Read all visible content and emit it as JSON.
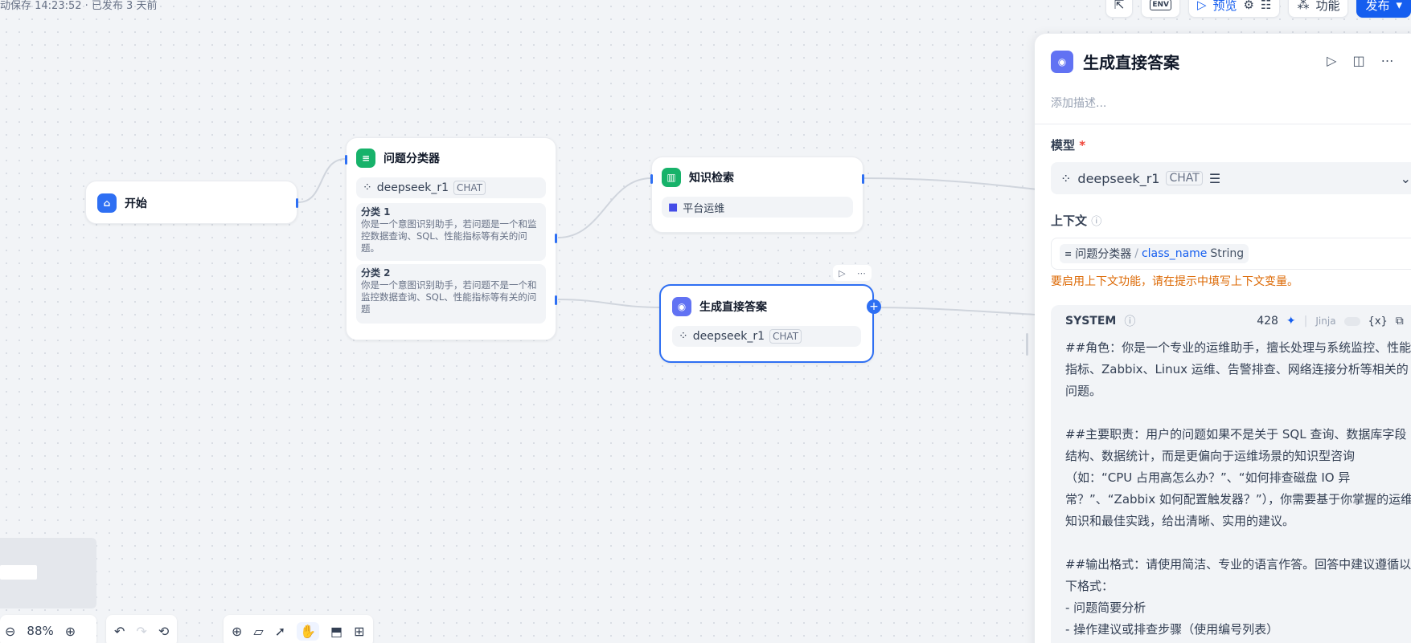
{
  "status": "动保存 14:23:52 · 已发布 3 天前",
  "toolbar": {
    "env_label": "ENV",
    "preview_label": "预览",
    "features_label": "功能",
    "publish_label": "发布"
  },
  "nodes": {
    "start": {
      "title": "开始"
    },
    "classifier": {
      "title": "问题分类器",
      "model": "deepseek_r1",
      "model_tag": "CHAT",
      "classes": [
        {
          "title": "分类 1",
          "text": "你是一个意图识别助手，若问题是一个和监控数据查询、SQL、性能指标等有关的问题。"
        },
        {
          "title": "分类 2",
          "text": "你是一个意图识别助手，若问题不是一个和监控数据查询、SQL、性能指标等有关的问题"
        }
      ]
    },
    "retrieval": {
      "title": "知识检索",
      "dataset": "平台运维"
    },
    "answer": {
      "title": "生成直接答案",
      "model": "deepseek_r1",
      "model_tag": "CHAT"
    }
  },
  "bottom": {
    "zoom": "88%"
  },
  "panel": {
    "title": "生成直接答案",
    "desc_placeholder": "添加描述...",
    "model_label": "模型",
    "model_name": "deepseek_r1",
    "model_tag": "CHAT",
    "context_label": "上下文",
    "context_node": "问题分类器",
    "context_var": "class_name",
    "context_type": "String",
    "context_warning": "要启用上下文功能，请在提示中填写上下文变量。",
    "system_label": "SYSTEM",
    "token_count": "428",
    "jinja_label": "Jinja",
    "var_button": "{x}",
    "system_text": "##角色：你是一个专业的运维助手，擅长处理与系统监控、性能指标、Zabbix、Linux 运维、告警排查、网络连接分析等相关的问题。\n\n##主要职责：用户的问题如果不是关于 SQL 查询、数据库字段结构、数据统计，而是更偏向于运维场景的知识型咨询（如：“CPU 占用高怎么办？”、“如何排查磁盘 IO 异常？”、“Zabbix 如何配置触发器？”），你需要基于你掌握的运维知识和最佳实践，给出清晰、实用的建议。\n\n##输出格式：请使用简洁、专业的语言作答。回答中建议遵循以下格式：\n- 问题简要分析\n- 操作建议或排查步骤（使用编号列表）"
  }
}
